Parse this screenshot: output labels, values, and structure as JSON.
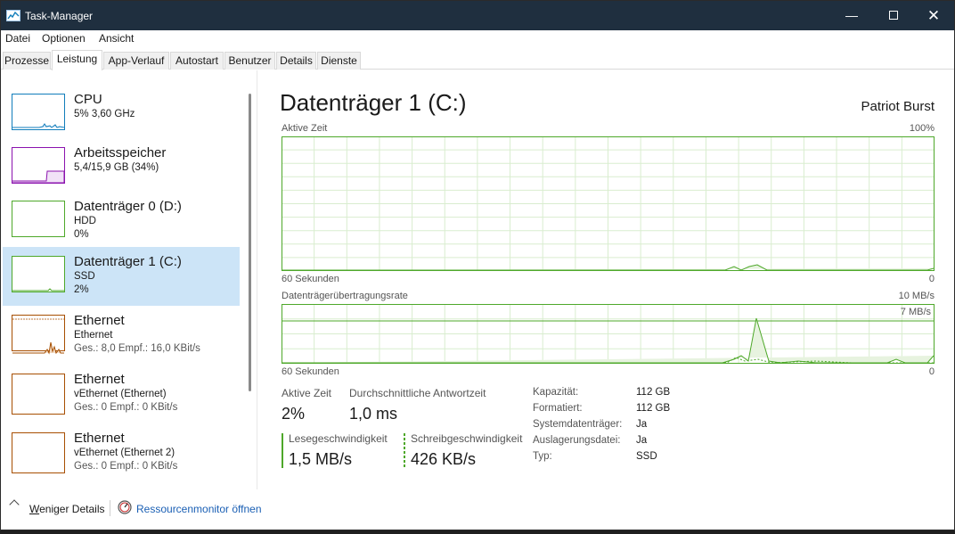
{
  "window": {
    "title": "Task-Manager",
    "minimize": "—",
    "close": "✕"
  },
  "menu": [
    "Datei",
    "Optionen",
    "Ansicht"
  ],
  "tabs": [
    "Prozesse",
    "Leistung",
    "App-Verlauf",
    "Autostart",
    "Benutzer",
    "Details",
    "Dienste"
  ],
  "active_tab": "Leistung",
  "resources": [
    {
      "name": "CPU",
      "line1": "5%  3,60 GHz",
      "line2": "",
      "color": "#117dbb"
    },
    {
      "name": "Arbeitsspeicher",
      "line1": "5,4/15,9 GB (34%)",
      "line2": "",
      "color": "#8b12ae"
    },
    {
      "name": "Datenträger 0 (D:)",
      "line1": "HDD",
      "line2": "0%",
      "color": "#4ea82a"
    },
    {
      "name": "Datenträger 1 (C:)",
      "line1": "SSD",
      "line2": "2%",
      "color": "#4ea82a"
    },
    {
      "name": "Ethernet",
      "line1": "Ethernet",
      "line2": "Ges.: 8,0  Empf.: 16,0 KBit/s",
      "color": "#a74f01"
    },
    {
      "name": "Ethernet",
      "line1": "vEthernet (Ethernet)",
      "line2": "Ges.: 0  Empf.: 0 KBit/s",
      "color": "#a74f01"
    },
    {
      "name": "Ethernet",
      "line1": "vEthernet (Ethernet 2)",
      "line2": "Ges.: 0  Empf.: 0 KBit/s",
      "color": "#a74f01"
    }
  ],
  "selected_resource": 3,
  "detail": {
    "title": "Datenträger 1 (C:)",
    "model": "Patriot Burst",
    "active_time_chart": {
      "label": "Aktive Zeit",
      "max": "100%",
      "x_left": "60 Sekunden",
      "x_right": "0"
    },
    "transfer_chart": {
      "label": "Datenträgerübertragungsrate",
      "max": "10 MB/s",
      "ref": "7 MB/s",
      "x_left": "60 Sekunden",
      "x_right": "0"
    },
    "stats": {
      "active_time_label": "Aktive Zeit",
      "active_time_value": "2%",
      "response_label": "Durchschnittliche Antwortzeit",
      "response_value": "1,0 ms",
      "read_label": "Lesegeschwindigkeit",
      "read_value": "1,5 MB/s",
      "write_label": "Schreibgeschwindigkeit",
      "write_value": "426 KB/s"
    },
    "info": [
      {
        "key": "Kapazität:",
        "value": "112 GB"
      },
      {
        "key": "Formatiert:",
        "value": "112 GB"
      },
      {
        "key": "Systemdatenträger:",
        "value": "Ja"
      },
      {
        "key": "Auslagerungsdatei:",
        "value": "Ja"
      },
      {
        "key": "Typ:",
        "value": "SSD"
      }
    ]
  },
  "footer": {
    "fewer_details_underlined": "W",
    "fewer_details_rest": "eniger Details",
    "resource_monitor": "Ressourcenmonitor öffnen"
  },
  "colors": {
    "disk": "#4ea82a",
    "selected_bg": "#cce4f7",
    "titlebar": "#1f2f3f",
    "link": "#1a5fb4"
  },
  "icons": [
    "app-chart-icon",
    "minimize-icon",
    "maximize-icon",
    "close-icon",
    "chevron-up-icon",
    "resource-monitor-icon"
  ]
}
